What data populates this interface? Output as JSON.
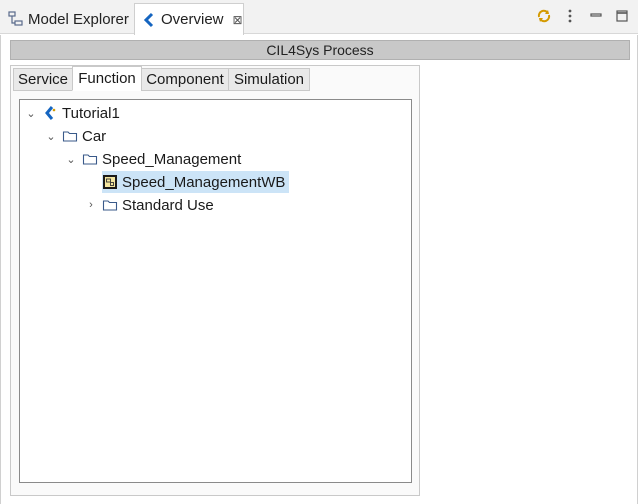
{
  "view_tabs": [
    {
      "label": "Model Explorer",
      "icon": "model-explorer-icon"
    },
    {
      "label": "Overview",
      "icon": "capella-icon",
      "close": "⊠"
    }
  ],
  "toolbar": {
    "icons": [
      "sync-icon",
      "kebab-menu-icon",
      "minimize-icon",
      "maximize-icon"
    ]
  },
  "process_title": "CIL4Sys Process",
  "editor_tabs": [
    "Service",
    "Function",
    "Component",
    "Simulation"
  ],
  "active_editor_tab": "Function",
  "tree": [
    {
      "label": "Tutorial1",
      "icon": "capella-project-icon",
      "expanded": true
    },
    {
      "label": "Car",
      "icon": "folder-icon",
      "expanded": true
    },
    {
      "label": "Speed_Management",
      "icon": "folder-icon",
      "expanded": true
    },
    {
      "label": "Speed_ManagementWB",
      "icon": "workbench-icon",
      "selected": true
    },
    {
      "label": "Standard Use",
      "icon": "folder-icon",
      "expanded": false
    }
  ],
  "colors": {
    "selection": "#cce4f7",
    "process_bar": "#c8c8c8",
    "accent": "#1565c0"
  }
}
